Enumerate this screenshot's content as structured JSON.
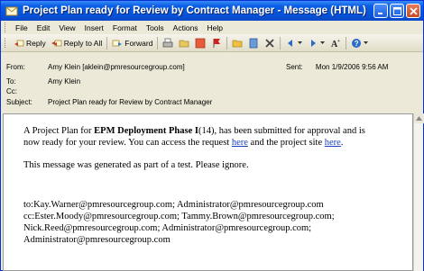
{
  "window": {
    "title": "Project Plan ready for Review by Contract Manager - Message (HTML)",
    "controls": [
      "minimize",
      "maximize",
      "close"
    ]
  },
  "menu": [
    "File",
    "Edit",
    "View",
    "Insert",
    "Format",
    "Tools",
    "Actions",
    "Help"
  ],
  "toolbar": {
    "reply": "Reply",
    "reply_all": "Reply to All",
    "forward": "Forward"
  },
  "header": {
    "from_label": "From:",
    "from_value": "Amy Klein [aklein@pmresourcegroup.com]",
    "sent_label": "Sent:",
    "sent_value": "Mon 1/9/2006 9:56 AM",
    "to_label": "To:",
    "to_value": "Amy Klein",
    "cc_label": "Cc:",
    "cc_value": "",
    "subject_label": "Subject:",
    "subject_value": "Project Plan ready for Review by Contract Manager"
  },
  "body": {
    "p1_a": "A Project Plan for ",
    "p1_bold": "EPM Deployment Phase I",
    "p1_b": "(14), has been submitted for approval and is",
    "p2_a": "now ready for your review.  You can access the request ",
    "link1": "here",
    "p2_b": " and the project site ",
    "link2": "here",
    "p2_c": ".",
    "p3": "This message was generated as part of a test. Please ignore.",
    "to_line": "to:Kay.Warner@pmresourcegroup.com; Administrator@pmresourcegroup.com",
    "cc_line": "cc:Ester.Moody@pmresourcegroup.com; Tammy.Brown@pmresourcegroup.com;",
    "line3": "Nick.Reed@pmresourcegroup.com; Administrator@pmresourcegroup.com;",
    "line4": "Administrator@pmresourcegroup.com"
  },
  "colors": {
    "titlebar": "#0553d9",
    "chrome": "#ece9d8",
    "link": "#1a3fbf"
  },
  "icons": [
    "envelope-icon",
    "reply-icon",
    "reply-all-icon",
    "forward-icon",
    "print-icon",
    "move-icon",
    "flag-icon",
    "categories-icon",
    "delete-icon",
    "previous-icon",
    "next-icon",
    "font-size-icon",
    "help-icon"
  ]
}
